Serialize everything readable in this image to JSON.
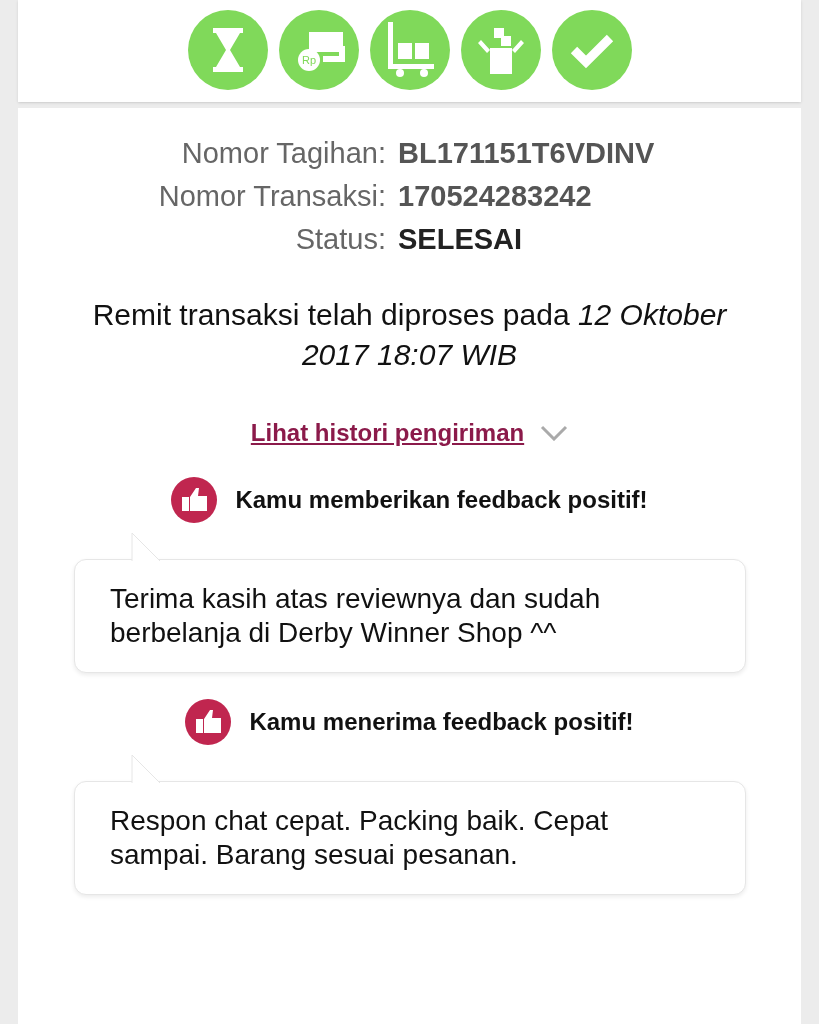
{
  "steps": [
    {
      "kind": "hourglass"
    },
    {
      "kind": "payment",
      "badge": "Rp"
    },
    {
      "kind": "shipping"
    },
    {
      "kind": "received"
    },
    {
      "kind": "done"
    }
  ],
  "details": [
    {
      "label": "Nomor Tagihan:",
      "value": "BL171151T6VDINV",
      "emphasis": false
    },
    {
      "label": "Nomor Transaksi:",
      "value": "170524283242",
      "emphasis": false
    },
    {
      "label": "Status:",
      "value": "SELESAI",
      "emphasis": true
    }
  ],
  "remit_note": "Remit transaksi telah diproses pada *12 Oktober 2017 18:07 WIB*",
  "history_link": {
    "label": "Lihat histori pengiriman",
    "expanded": false
  },
  "feedback": [
    {
      "heading": "Kamu memberikan feedback positif!",
      "message": "Terima kasih atas reviewnya dan sudah berbelanja di Derby Winner Shop ^^"
    },
    {
      "heading": "Kamu menerima feedback positif!",
      "message": "Respon chat cepat. Packing baik. Cepat sampai. Barang sesuai pesanan."
    }
  ]
}
